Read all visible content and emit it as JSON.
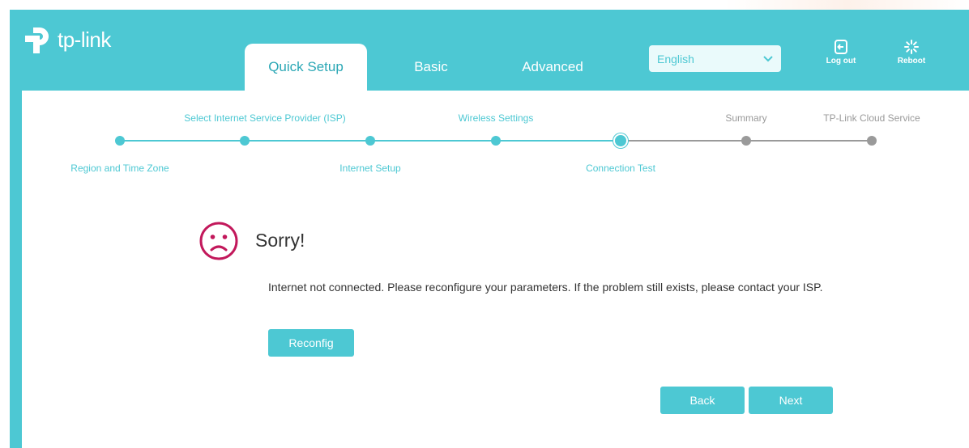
{
  "brand": {
    "name": "tp-link"
  },
  "tabs": [
    {
      "label": "Quick Setup"
    },
    {
      "label": "Basic"
    },
    {
      "label": "Advanced"
    }
  ],
  "language": {
    "selected": "English"
  },
  "header_buttons": {
    "logout": "Log out",
    "reboot": "Reboot"
  },
  "wizard": {
    "steps": [
      {
        "label": "Region and Time Zone",
        "state": "done"
      },
      {
        "label": "Select Internet Service Provider (ISP)",
        "state": "done"
      },
      {
        "label": "Internet Setup",
        "state": "done"
      },
      {
        "label": "Wireless Settings",
        "state": "done"
      },
      {
        "label": "Connection Test",
        "state": "current"
      },
      {
        "label": "Summary",
        "state": "todo"
      },
      {
        "label": "TP-Link Cloud Service",
        "state": "todo"
      }
    ]
  },
  "result": {
    "title": "Sorry!",
    "message": "Internet not connected. Please reconfigure your parameters. If the problem still exists, please contact your ISP.",
    "reconfig_label": "Reconfig"
  },
  "nav": {
    "back_label": "Back",
    "next_label": "Next"
  },
  "colors": {
    "accent": "#4dc8d3",
    "error": "#c2185b",
    "inactive": "#9a9a9a"
  },
  "icons": {
    "logo": "tp-link-logo-icon",
    "logout": "logout-icon",
    "reboot": "reboot-icon",
    "dropdown": "chevron-down-icon",
    "status": "sad-face-icon"
  }
}
